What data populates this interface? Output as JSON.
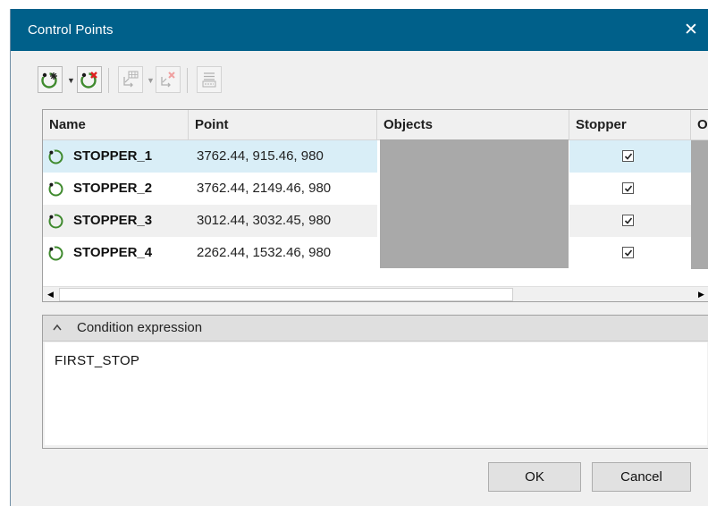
{
  "window": {
    "title": "Control Points",
    "close_glyph": "✕"
  },
  "toolbar": {
    "buttons": [
      {
        "icon": "add-control-point-icon",
        "enabled": true,
        "has_dropdown": true
      },
      {
        "icon": "delete-control-point-icon",
        "enabled": true,
        "has_dropdown": false
      },
      {
        "icon": "table-arrow-icon",
        "enabled": false,
        "has_dropdown": true
      },
      {
        "icon": "remove-object-icon",
        "enabled": false,
        "has_dropdown": false
      },
      {
        "icon": "edit-list-icon",
        "enabled": false,
        "has_dropdown": false
      }
    ]
  },
  "grid": {
    "columns": [
      "Name",
      "Point",
      "Objects",
      "Stopper",
      "O"
    ],
    "rows": [
      {
        "name": "STOPPER_1",
        "point": "3762.44, 915.46, 980",
        "stopper": true,
        "selected": true
      },
      {
        "name": "STOPPER_2",
        "point": "3762.44, 2149.46, 980",
        "stopper": true,
        "selected": false
      },
      {
        "name": "STOPPER_3",
        "point": "3012.44, 3032.45, 980",
        "stopper": true,
        "selected": false
      },
      {
        "name": "STOPPER_4",
        "point": "2262.44, 1532.46, 980",
        "stopper": true,
        "selected": false
      }
    ],
    "scroll_left_glyph": "◀",
    "scroll_right_glyph": "▶"
  },
  "condition": {
    "title": "Condition expression",
    "collapsed": false,
    "expression": "FIRST_STOP"
  },
  "buttons": {
    "ok": "OK",
    "cancel": "Cancel"
  },
  "colors": {
    "titlebar": "#00608a",
    "selection": "#d9eef7",
    "alt_row": "#f0f0f0",
    "icon_green": "#3f8a2e",
    "icon_red": "#e02020"
  }
}
